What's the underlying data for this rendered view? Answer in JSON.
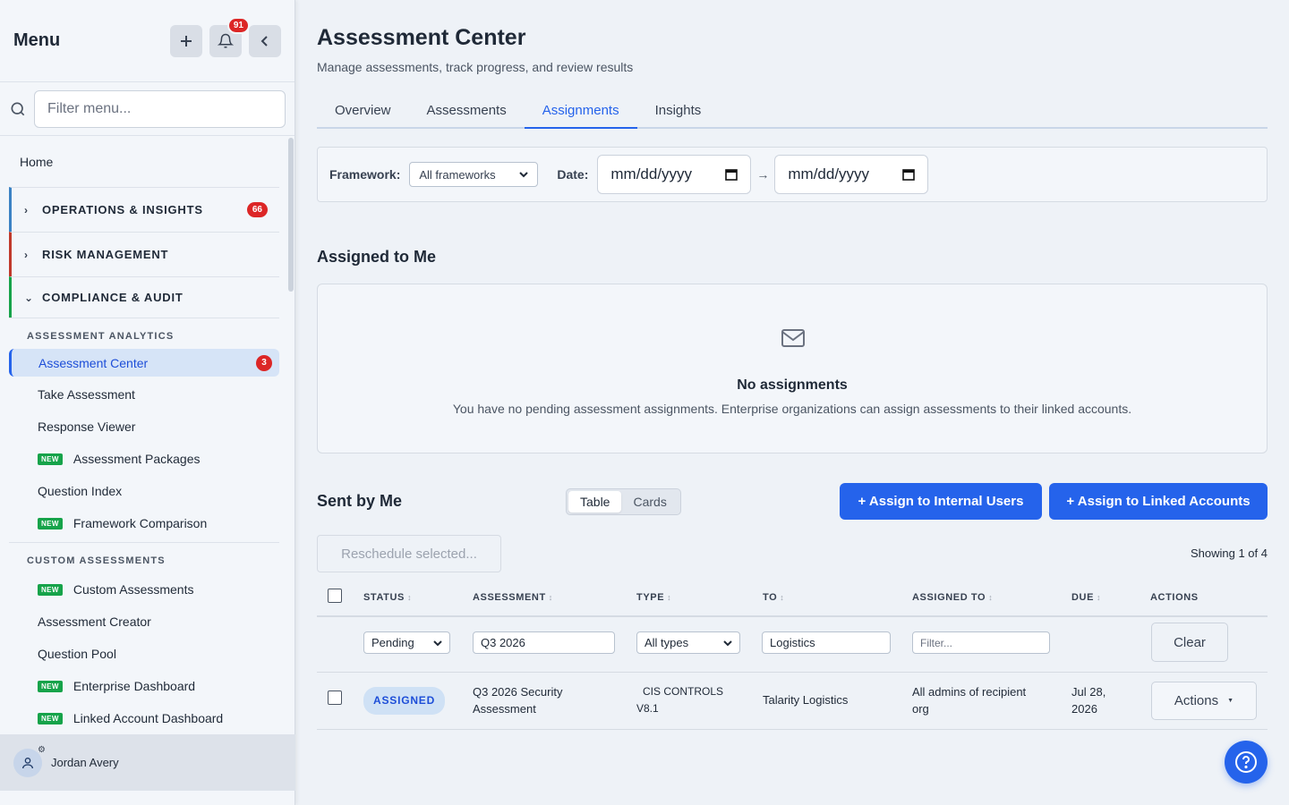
{
  "sidebar": {
    "title": "Menu",
    "notif_count": "91",
    "filter_placeholder": "Filter menu...",
    "home": "Home",
    "groups": [
      {
        "label": "OPERATIONS & INSIGHTS",
        "badge": "66",
        "color": "#3b82c4"
      },
      {
        "label": "RISK MANAGEMENT",
        "color": "#c0392b"
      },
      {
        "label": "COMPLIANCE & AUDIT",
        "color": "#16a34a"
      }
    ],
    "sections": [
      "ASSESSMENT ANALYTICS",
      "CUSTOM ASSESSMENTS"
    ],
    "new_tag": "NEW",
    "items_a": [
      {
        "label": "Assessment Center",
        "badge": "3",
        "active": true
      },
      {
        "label": "Take Assessment"
      },
      {
        "label": "Response Viewer"
      },
      {
        "label": "Assessment Packages",
        "new": true
      },
      {
        "label": "Question Index"
      },
      {
        "label": "Framework Comparison",
        "new": true
      }
    ],
    "items_b": [
      {
        "label": "Custom Assessments",
        "new": true
      },
      {
        "label": "Assessment Creator"
      },
      {
        "label": "Question Pool"
      },
      {
        "label": "Enterprise Dashboard",
        "new": true
      },
      {
        "label": "Linked Account Dashboard",
        "new": true
      }
    ],
    "user": "Jordan Avery"
  },
  "page": {
    "title": "Assessment Center",
    "subtitle": "Manage assessments, track progress, and review results",
    "tabs": [
      "Overview",
      "Assessments",
      "Assignments",
      "Insights"
    ],
    "active_tab": "Assignments"
  },
  "filters": {
    "framework_label": "Framework:",
    "framework_value": "All frameworks",
    "date_label": "Date:",
    "date_from": "mm/dd/yyyy",
    "date_sep": "→",
    "date_to": "mm/dd/yyyy"
  },
  "assigned_to_me": {
    "title": "Assigned to Me",
    "empty_title": "No assignments",
    "empty_text": "You have no pending assessment assignments. Enterprise organizations can assign assessments to their linked accounts."
  },
  "sent_by_me": {
    "title": "Sent by Me",
    "view_table": "Table",
    "view_cards": "Cards",
    "btn_internal": "+ Assign to Internal Users",
    "btn_linked": "+ Assign to Linked Accounts",
    "reschedule": "Reschedule selected...",
    "showing": "Showing 1 of 4",
    "columns": [
      "STATUS",
      "ASSESSMENT",
      "TYPE",
      "TO",
      "ASSIGNED TO",
      "DUE",
      "ACTIONS"
    ],
    "filter_status": "Pending",
    "filter_assessment": "Q3 2026",
    "filter_type": "All types",
    "filter_to": "Logistics",
    "filter_assigned_placeholder": "Filter...",
    "clear": "Clear",
    "rows": [
      {
        "status": "ASSIGNED",
        "assessment_1": "Q3 2026 Security",
        "assessment_2": "Assessment",
        "type_1": "CIS CONTROLS",
        "type_2": "V8.1",
        "to": "Talarity Logistics",
        "assigned_1": "All admins of recipient",
        "assigned_2": "org",
        "due_1": "Jul 28,",
        "due_2": "2026",
        "actions": "Actions"
      }
    ]
  },
  "colors": {
    "accent": "#2563eb",
    "badge": "#dc2626",
    "new": "#16a34a"
  }
}
